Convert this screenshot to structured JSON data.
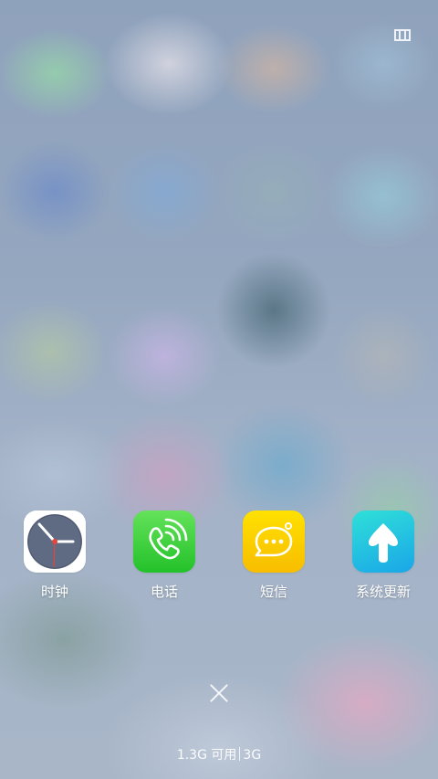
{
  "apps": [
    {
      "label": "时钟",
      "icon": "clock-icon",
      "color": "#ffffff"
    },
    {
      "label": "电话",
      "icon": "phone-icon",
      "color": "#2ec734"
    },
    {
      "label": "短信",
      "icon": "message-icon",
      "color": "#fbc800"
    },
    {
      "label": "系统更新",
      "icon": "update-arrow-icon",
      "color": "#22b5e4"
    }
  ],
  "memory": {
    "available": "1.3G 可用",
    "total": "3G"
  },
  "icons": {
    "top_right": "multi-window-icon",
    "close": "close-icon"
  }
}
